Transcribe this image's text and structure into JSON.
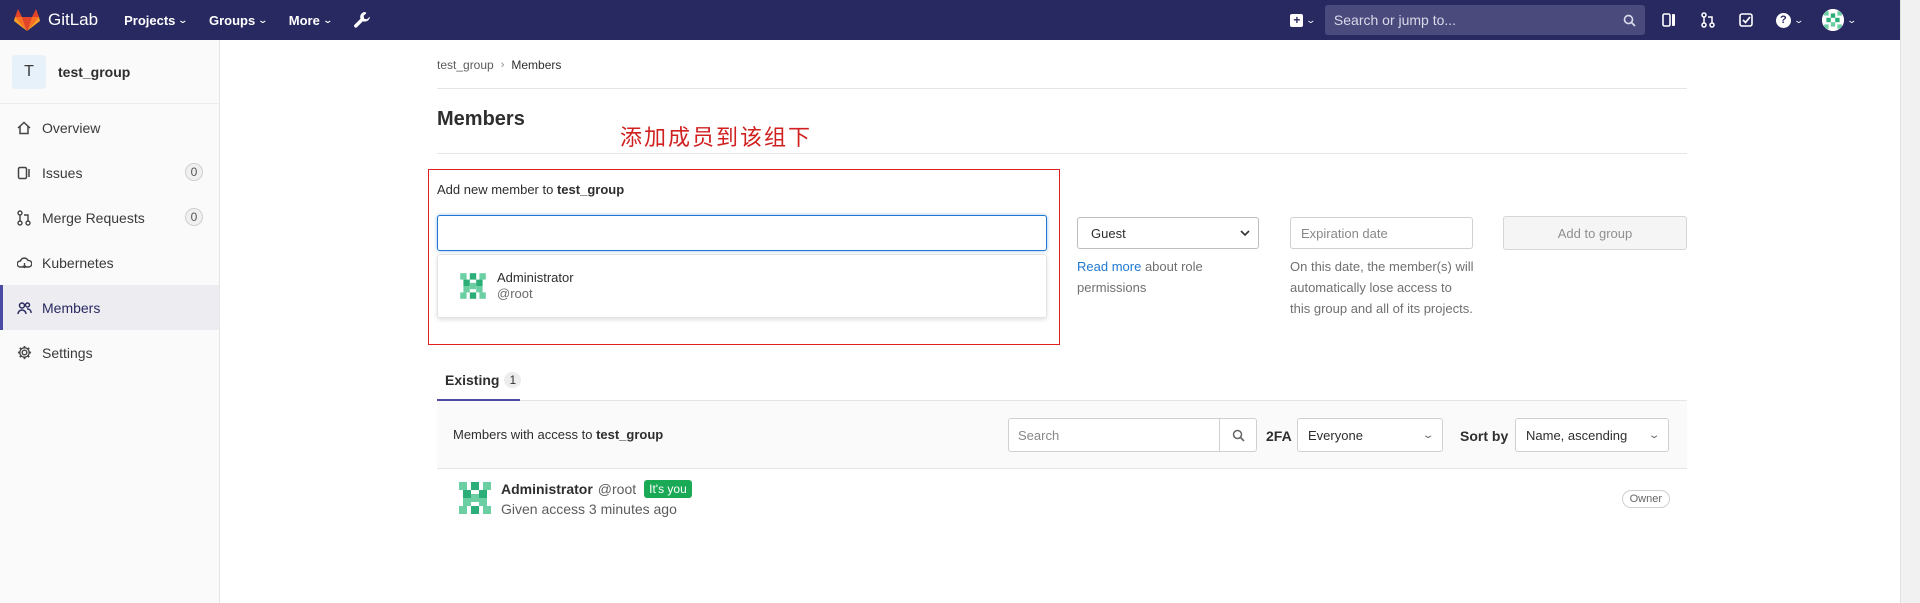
{
  "navbar": {
    "brand": "GitLab",
    "menu": [
      {
        "label": "Projects"
      },
      {
        "label": "Groups"
      },
      {
        "label": "More"
      }
    ],
    "search_placeholder": "Search or jump to..."
  },
  "sidebar": {
    "group_initial": "T",
    "group_name": "test_group",
    "items": [
      {
        "label": "Overview",
        "icon": "home-icon"
      },
      {
        "label": "Issues",
        "icon": "issues-icon",
        "count": "0"
      },
      {
        "label": "Merge Requests",
        "icon": "merge-request-icon",
        "count": "0"
      },
      {
        "label": "Kubernetes",
        "icon": "kubernetes-icon"
      },
      {
        "label": "Members",
        "icon": "users-icon",
        "active": true
      },
      {
        "label": "Settings",
        "icon": "gear-icon"
      }
    ]
  },
  "breadcrumb": {
    "group": "test_group",
    "current": "Members"
  },
  "page": {
    "title": "Members",
    "annotation": "添加成员到该组下"
  },
  "add_member": {
    "label_prefix": "Add new member to",
    "group": "test_group",
    "input_value": "",
    "suggestion": {
      "name": "Administrator",
      "username": "@root"
    },
    "role_selected": "Guest",
    "role_help_link": "Read more",
    "role_help_text": "about role permissions",
    "expiration_placeholder": "Expiration date",
    "expiration_help": "On this date, the member(s) will automatically lose access to this group and all of its projects.",
    "add_button": "Add to group"
  },
  "tabs": [
    {
      "label": "Existing",
      "count": "1"
    }
  ],
  "members_panel": {
    "label_prefix": "Members with access to",
    "group": "test_group",
    "search_placeholder": "Search",
    "tfa_label": "2FA",
    "tfa_selected": "Everyone",
    "sort_label": "Sort by",
    "sort_selected": "Name, ascending"
  },
  "members": [
    {
      "name": "Administrator",
      "username": "@root",
      "badge": "It's you",
      "access": "Given access 3 minutes ago",
      "role": "Owner"
    }
  ],
  "colors": {
    "navbar": "#292961",
    "annotation": "#d02020",
    "accent": "#1f78d1",
    "badge_you": "#1aaa55"
  }
}
